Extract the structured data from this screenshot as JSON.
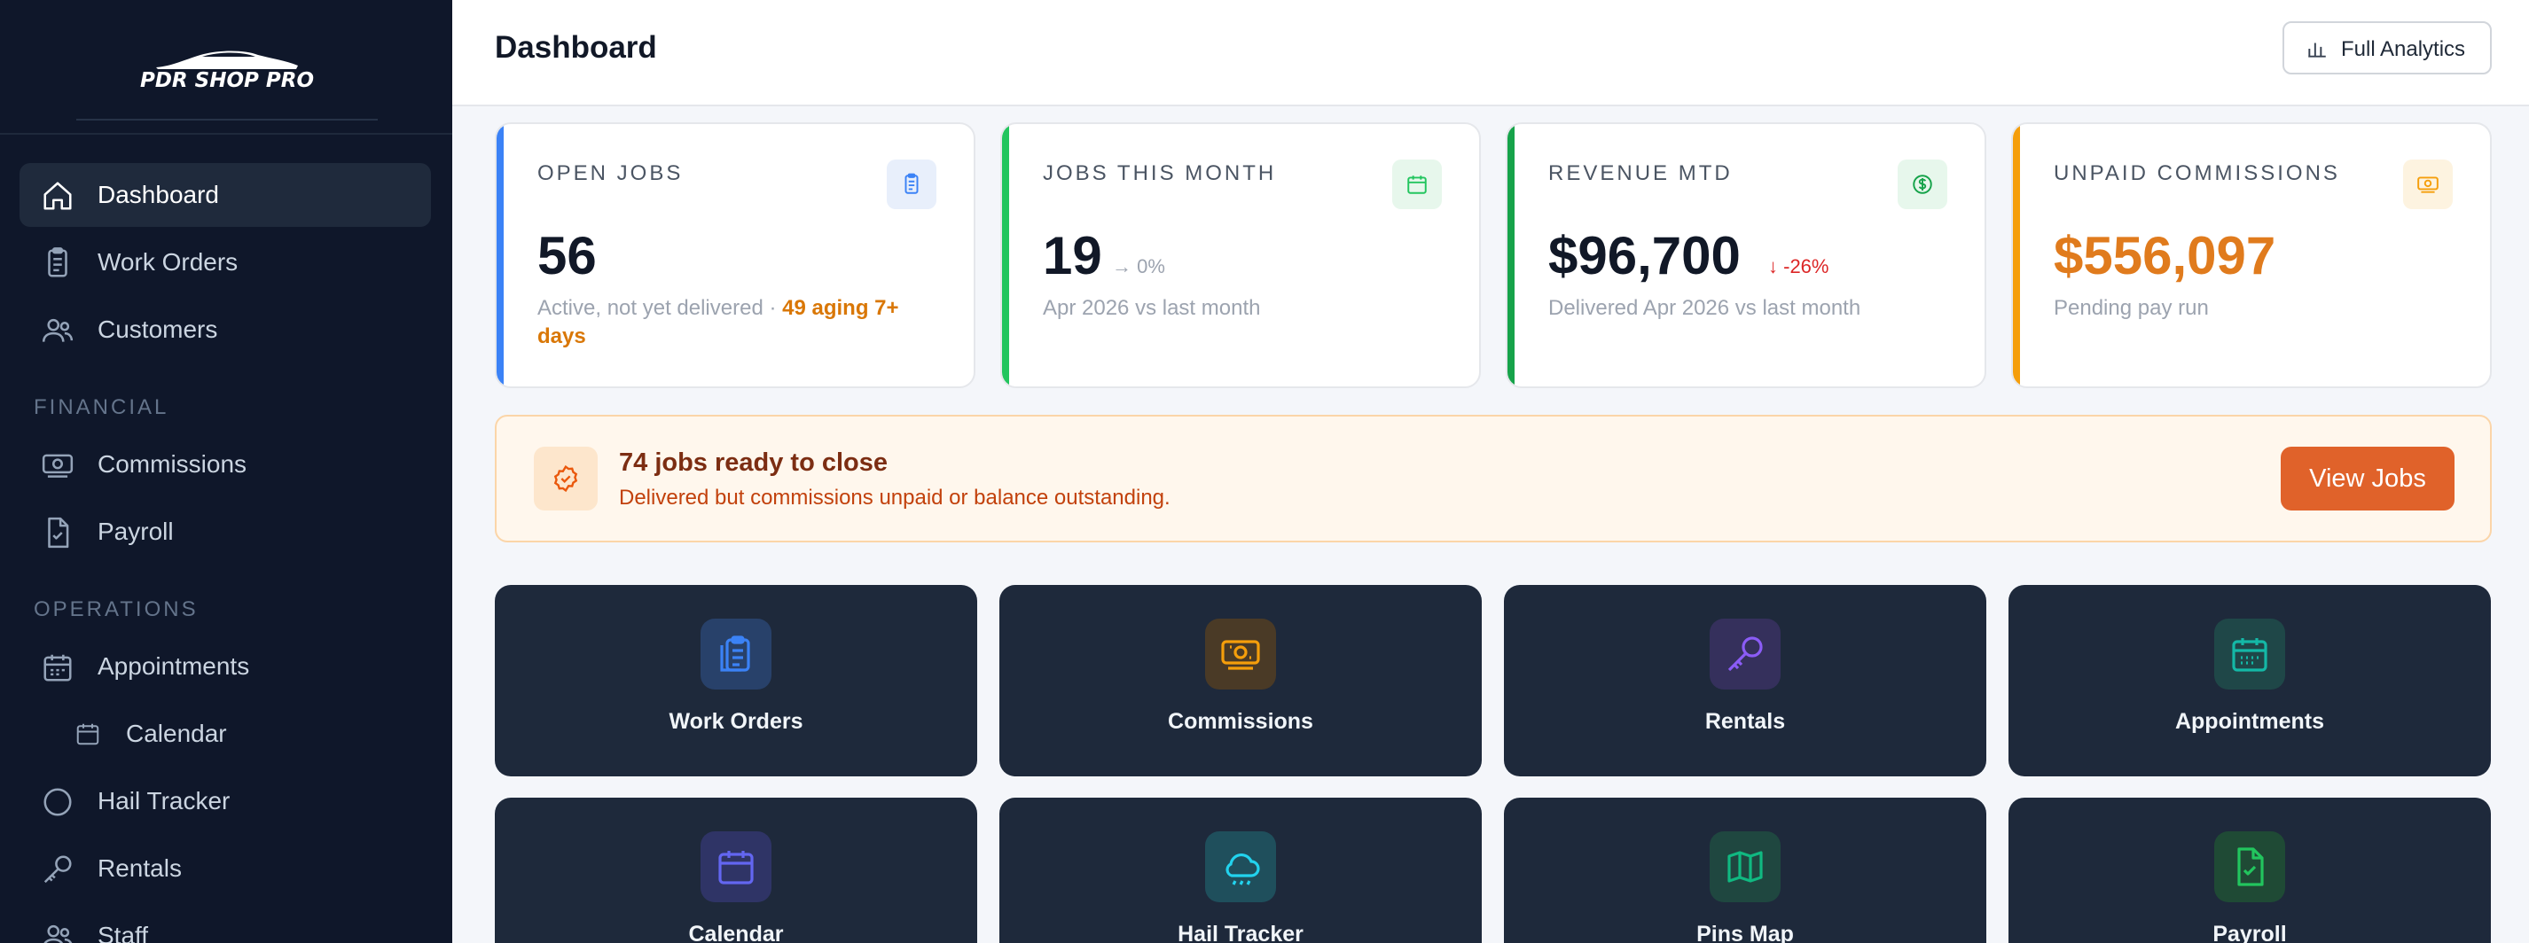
{
  "brand": {
    "name": "PDR SHOP PRO",
    "logo_icon": "car-silhouette-icon"
  },
  "sidebar": {
    "items": [
      {
        "label": "Dashboard",
        "icon": "home-icon",
        "active": true
      },
      {
        "label": "Work Orders",
        "icon": "clipboard-icon"
      },
      {
        "label": "Customers",
        "icon": "users-icon"
      }
    ],
    "financial_heading": "FINANCIAL",
    "financial": [
      {
        "label": "Commissions",
        "icon": "banknote-icon"
      },
      {
        "label": "Payroll",
        "icon": "file-check-icon"
      }
    ],
    "operations_heading": "OPERATIONS",
    "operations": [
      {
        "label": "Appointments",
        "icon": "calendar-grid-icon"
      },
      {
        "label": "Calendar",
        "icon": "calendar-icon",
        "sub": true
      },
      {
        "label": "Hail Tracker",
        "icon": "circle-icon"
      },
      {
        "label": "Rentals",
        "icon": "key-icon"
      },
      {
        "label": "Staff",
        "icon": "users-icon"
      }
    ]
  },
  "header": {
    "title": "Dashboard",
    "analytics_label": "Full Analytics",
    "analytics_icon": "bar-chart-icon"
  },
  "stats": [
    {
      "title": "OPEN JOBS",
      "value": "56",
      "sub": "Active, not yet delivered · ",
      "warn": "49 aging 7+ days",
      "accent": "#3b82f6",
      "icon": "clipboard-icon"
    },
    {
      "title": "JOBS THIS MONTH",
      "value": "19",
      "delta": "→ 0%",
      "sub": "Apr 2026 vs last month",
      "accent": "#22c55e",
      "icon": "calendar-icon"
    },
    {
      "title": "REVENUE MTD",
      "value": "$96,700",
      "delta": "↓ -26%",
      "sub": "Delivered Apr 2026 vs last month",
      "accent": "#16a34a",
      "icon": "dollar-circle-icon"
    },
    {
      "title": "UNPAID COMMISSIONS",
      "value": "$556,097",
      "sub": "Pending pay run",
      "accent": "#f59e0b",
      "icon": "banknote-icon"
    }
  ],
  "alert": {
    "title": "74 jobs ready to close",
    "description": "Delivered but commissions unpaid or balance outstanding.",
    "button": "View Jobs",
    "icon": "check-badge-icon"
  },
  "tiles": [
    {
      "label": "Work Orders",
      "icon": "clipboard-icon",
      "color": "#3b82f6"
    },
    {
      "label": "Commissions",
      "icon": "banknote-icon",
      "color": "#f59e0b"
    },
    {
      "label": "Rentals",
      "icon": "key-icon",
      "color": "#8b5cf6"
    },
    {
      "label": "Appointments",
      "icon": "calendar-grid-icon",
      "color": "#14b8a6"
    },
    {
      "label": "Calendar",
      "icon": "calendar-icon",
      "color": "#6366f1"
    },
    {
      "label": "Hail Tracker",
      "icon": "cloud-icon",
      "color": "#22d3ee"
    },
    {
      "label": "Pins Map",
      "icon": "map-icon",
      "color": "#10b981"
    },
    {
      "label": "Payroll",
      "icon": "file-check-icon",
      "color": "#22c55e"
    }
  ]
}
